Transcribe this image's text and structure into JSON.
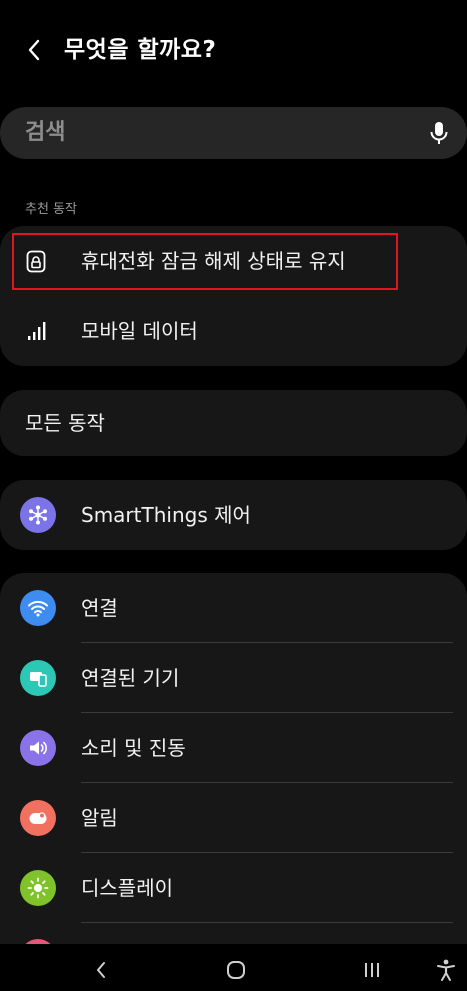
{
  "header": {
    "title": "무엇을 할까요?"
  },
  "search": {
    "placeholder": "검색"
  },
  "recommended": {
    "label": "추천 동작",
    "items": [
      {
        "label": "휴대전화 잠금 해제 상태로 유지",
        "icon": "lock-icon"
      },
      {
        "label": "모바일 데이터",
        "icon": "signal-bars-icon"
      }
    ]
  },
  "all_actions": {
    "label": "모든 동작"
  },
  "smartthings": {
    "label": "SmartThings 제어",
    "icon": "smartthings-icon",
    "color": "#7b74e8"
  },
  "settings": {
    "items": [
      {
        "label": "연결",
        "icon": "wifi-icon",
        "color": "#3f8cf0"
      },
      {
        "label": "연결된 기기",
        "icon": "connected-devices-icon",
        "color": "#2cc7b5"
      },
      {
        "label": "소리 및 진동",
        "icon": "volume-icon",
        "color": "#8a72e8"
      },
      {
        "label": "알림",
        "icon": "notification-icon",
        "color": "#f2705f"
      },
      {
        "label": "디스플레이",
        "icon": "brightness-icon",
        "color": "#80c22a"
      }
    ]
  },
  "colors": {
    "background": "#000000",
    "card": "#171717",
    "search": "#262626",
    "highlight": "#e0161f"
  }
}
